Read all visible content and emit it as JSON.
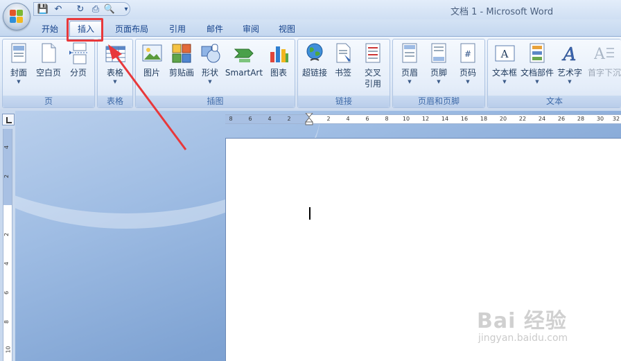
{
  "window": {
    "title": "文档 1 - Microsoft Word"
  },
  "quick_access": [
    {
      "name": "save",
      "icon": "save-icon",
      "glyph": "💾"
    },
    {
      "name": "undo",
      "icon": "undo-icon",
      "glyph": "↶"
    },
    {
      "name": "redo",
      "icon": "redo-icon",
      "glyph": "↻"
    },
    {
      "name": "print",
      "icon": "print-icon",
      "glyph": "⎙"
    },
    {
      "name": "preview",
      "icon": "print-preview-icon",
      "glyph": "🔍"
    },
    {
      "name": "customize",
      "icon": "dropdown-icon",
      "glyph": "▾"
    }
  ],
  "tabs": [
    {
      "label": "开始"
    },
    {
      "label": "插入",
      "active": true
    },
    {
      "label": "页面布局"
    },
    {
      "label": "引用"
    },
    {
      "label": "邮件"
    },
    {
      "label": "审阅"
    },
    {
      "label": "视图"
    }
  ],
  "groups": {
    "pages": {
      "label": "页",
      "buttons": [
        {
          "label": "封面"
        },
        {
          "label": "空白页"
        },
        {
          "label": "分页"
        }
      ]
    },
    "tables": {
      "label": "表格",
      "buttons": [
        {
          "label": "表格"
        }
      ]
    },
    "illustrations": {
      "label": "插图",
      "buttons": [
        {
          "label": "图片"
        },
        {
          "label": "剪贴画"
        },
        {
          "label": "形状"
        },
        {
          "label": "SmartArt"
        },
        {
          "label": "图表"
        }
      ]
    },
    "links": {
      "label": "链接",
      "buttons": [
        {
          "label": "超链接"
        },
        {
          "label": "书签"
        },
        {
          "label": "交叉",
          "label2": "引用"
        }
      ]
    },
    "header_footer": {
      "label": "页眉和页脚",
      "buttons": [
        {
          "label": "页眉"
        },
        {
          "label": "页脚"
        },
        {
          "label": "页码"
        }
      ]
    },
    "text": {
      "label": "文本",
      "buttons": [
        {
          "label": "文本框"
        },
        {
          "label": "文档部件"
        },
        {
          "label": "艺术字"
        },
        {
          "label": "首字下沉"
        }
      ]
    }
  },
  "ruler": {
    "h_ticks": [
      "8",
      "6",
      "4",
      "2",
      "2",
      "4",
      "6",
      "8",
      "10",
      "12",
      "14",
      "16",
      "18",
      "20",
      "22",
      "24",
      "26",
      "28",
      "30",
      "32"
    ],
    "v_ticks": [
      "4",
      "2",
      "2",
      "4",
      "6",
      "8",
      "10"
    ]
  },
  "watermark": {
    "brand": "Bai 经验",
    "url": "jingyan.baidu.com"
  },
  "colors": {
    "highlight": "#e8383b",
    "tab_text": "#15428b"
  }
}
